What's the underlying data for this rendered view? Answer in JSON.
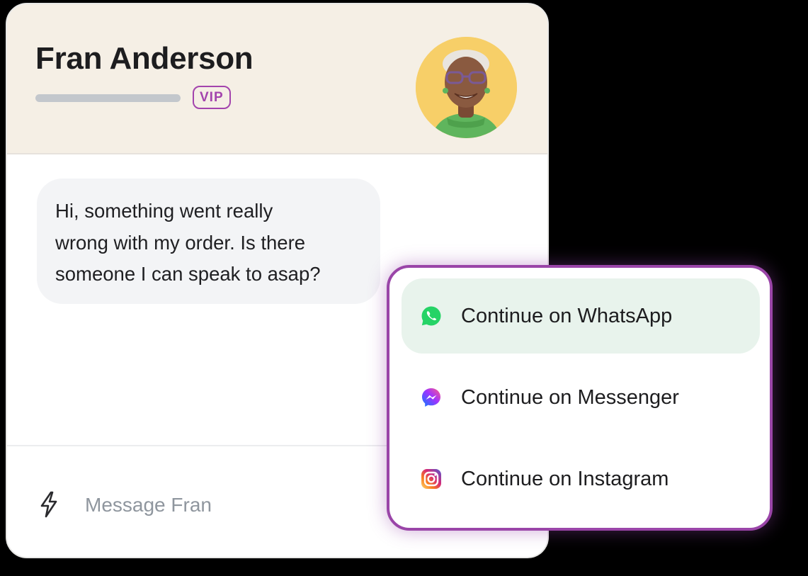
{
  "header": {
    "customer_name": "Fran Anderson",
    "badge": "VIP"
  },
  "conversation": {
    "message": "Hi, something went really\nwrong with my order. Is there\nsomeone I can speak to asap?"
  },
  "composer": {
    "placeholder": "Message Fran"
  },
  "channel_menu": {
    "options": [
      {
        "label": "Continue on WhatsApp",
        "icon": "whatsapp-icon",
        "active": true
      },
      {
        "label": "Continue on Messenger",
        "icon": "messenger-icon",
        "active": false
      },
      {
        "label": "Continue on Instagram",
        "icon": "instagram-icon",
        "active": false
      }
    ]
  },
  "colors": {
    "header_bg": "#f5efe5",
    "accent_purple": "#9a45a8",
    "active_option_bg": "#e8f3ec",
    "whatsapp_green": "#25d366"
  }
}
